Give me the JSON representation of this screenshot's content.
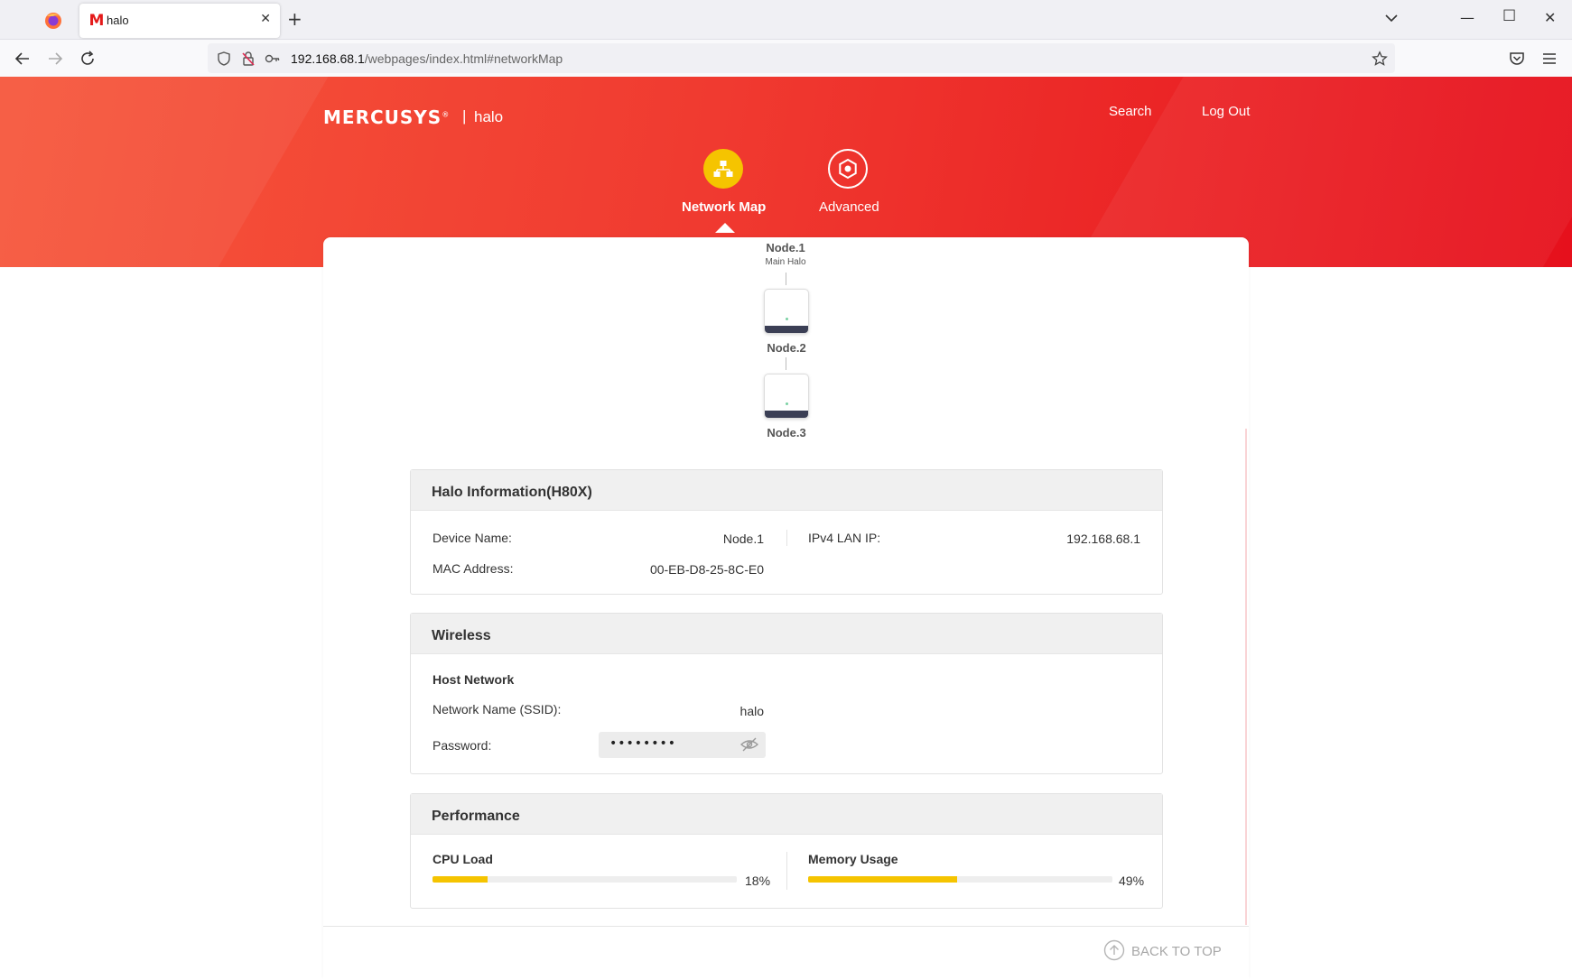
{
  "browser": {
    "tab_title": "halo",
    "tab_favicon": "M",
    "url_host": "192.168.68.1",
    "url_path": "/webpages/index.html#networkMap"
  },
  "header": {
    "brand": "MERCUSYS",
    "brand_mark": "®",
    "separator": "|",
    "device_name": "halo",
    "search_label": "Search",
    "logout_label": "Log Out"
  },
  "nav": {
    "items": [
      {
        "label": "Network Map",
        "icon": "network-map-icon",
        "active": true,
        "color": "#f5c400"
      },
      {
        "label": "Advanced",
        "icon": "advanced-gear-icon",
        "active": false
      }
    ]
  },
  "nodes": [
    {
      "name": "Node.1",
      "role": "Main Halo"
    },
    {
      "name": "Node.2"
    },
    {
      "name": "Node.3"
    }
  ],
  "halo_info": {
    "title": "Halo Information(H80X)",
    "device_name_label": "Device Name:",
    "device_name_value": "Node.1",
    "ipv4_label": "IPv4 LAN IP:",
    "ipv4_value": "192.168.68.1",
    "mac_label": "MAC Address:",
    "mac_value": "00-EB-D8-25-8C-E0"
  },
  "wireless": {
    "title": "Wireless",
    "host_network_label": "Host Network",
    "ssid_label": "Network Name (SSID):",
    "ssid_value": "halo",
    "password_label": "Password:",
    "password_value": "••••••••"
  },
  "performance": {
    "title": "Performance",
    "cpu_label": "CPU Load",
    "cpu_value": "18%",
    "cpu_fraction": 0.18,
    "memory_label": "Memory Usage",
    "memory_value": "49%",
    "memory_fraction": 0.49,
    "bar_color": "#f5c400"
  },
  "footer": {
    "back_to_top_label": "BACK TO TOP"
  }
}
